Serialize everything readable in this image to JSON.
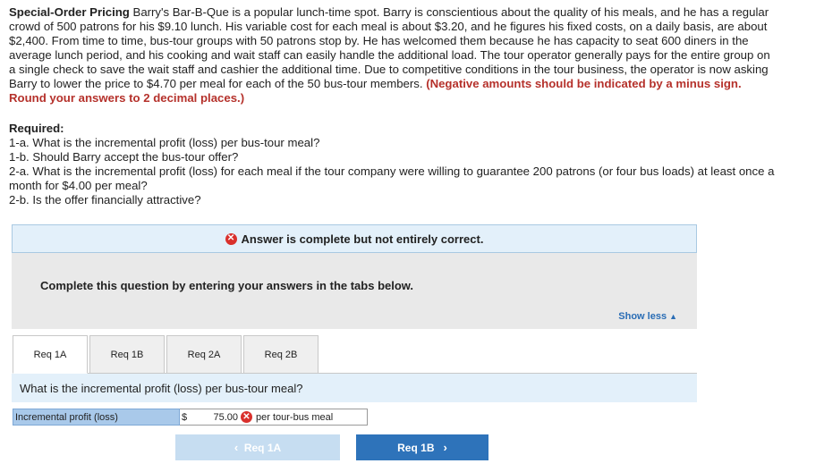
{
  "problem": {
    "title": "Special-Order Pricing",
    "body": " Barry's Bar-B-Que is a popular lunch-time spot. Barry is conscientious about the quality of his meals, and he has a regular crowd of 500 patrons for his $9.10 lunch. His variable cost for each meal is about $3.20, and he figures his fixed costs, on a daily basis, are about $2,400. From time to time, bus-tour groups with 50 patrons stop by. He has welcomed them because he has capacity to seat 600 diners in the average lunch period, and his cooking and wait staff can easily handle the additional load. The tour operator generally pays for the entire group on a single check to save the wait staff and cashier the additional time. Due to competitive conditions in the tour business, the operator is now asking Barry to lower the price to $4.70 per meal for each of the 50 bus-tour members. ",
    "note": "(Negative amounts should be indicated by a minus sign. Round your answers to 2 decimal places.)"
  },
  "required": {
    "heading": "Required:",
    "items": [
      "1-a. What is the incremental profit (loss) per bus-tour meal?",
      "1-b. Should Barry accept the bus-tour offer?",
      "2-a. What is the incremental profit (loss) for each meal if the tour company were willing to guarantee 200 patrons (or four bus loads) at least once a month for $4.00 per meal?",
      "2-b. Is the offer financially attractive?"
    ]
  },
  "status": {
    "icon": "x-circle-icon",
    "text": "Answer is complete but not entirely correct."
  },
  "panel": {
    "instruction": "Complete this question by entering your answers in the tabs below.",
    "show_less": "Show less"
  },
  "tabs": [
    "Req 1A",
    "Req 1B",
    "Req 2A",
    "Req 2B"
  ],
  "active_tab": 0,
  "question": "What is the incremental profit (loss) per bus-tour meal?",
  "answer": {
    "label": "Incremental profit (loss)",
    "currency": "$",
    "value": "75.00",
    "unit": "per tour-bus meal"
  },
  "nav": {
    "prev_label": "Req 1A",
    "next_label": "Req 1B"
  },
  "colors": {
    "note_red": "#b5312b",
    "accent_blue": "#2e73ba",
    "error_red": "#d9302c"
  }
}
